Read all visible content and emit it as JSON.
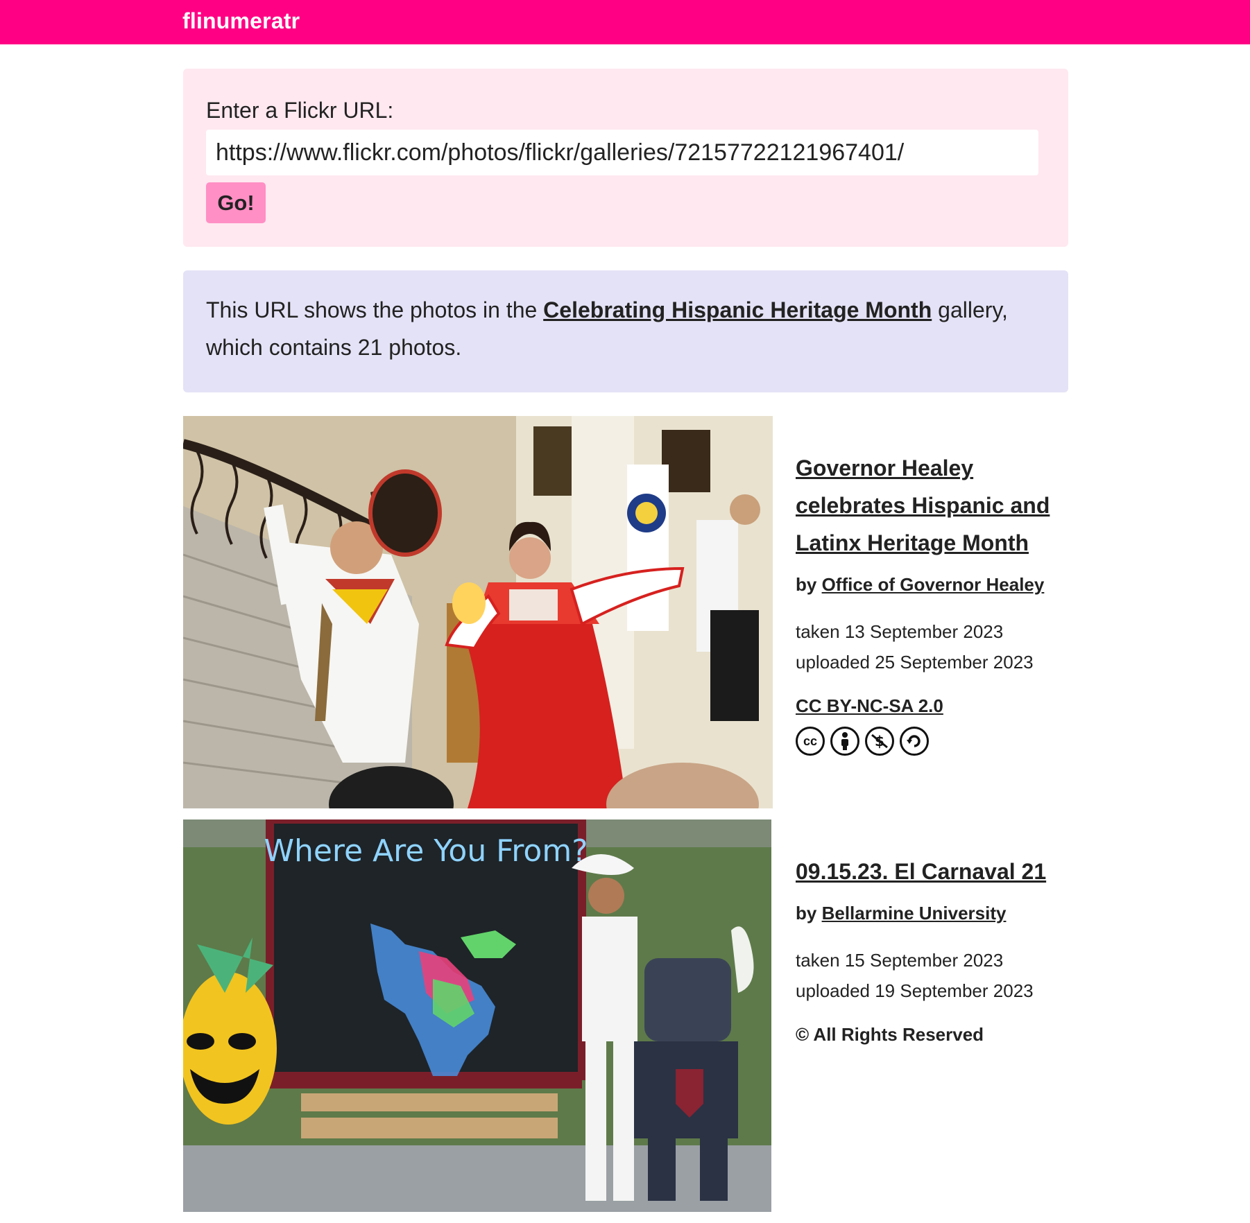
{
  "app": {
    "name": "flinumeratr"
  },
  "form": {
    "label": "Enter a Flickr URL:",
    "url_value": "https://www.flickr.com/photos/flickr/galleries/72157722121967401/",
    "go_label": "Go!"
  },
  "info": {
    "prefix": "This URL shows the photos in the",
    "gallery_title": "Celebrating Hispanic Heritage Month",
    "suffix": "gallery, which contains 21 photos."
  },
  "photos": [
    {
      "title": "Governor Healey celebrates Hispanic and Latinx Heritage Month",
      "by_prefix": "by",
      "owner": "Office of Governor Healey",
      "taken": "taken 13 September 2023",
      "uploaded": "uploaded 25 September 2023",
      "license": "CC BY-NC-SA 2.0",
      "license_icons": [
        "cc-icon",
        "attribution-icon",
        "non-commercial-icon",
        "share-alike-icon"
      ]
    },
    {
      "title": "09.15.23. El Carnaval 21",
      "by_prefix": "by",
      "owner": "Bellarmine University",
      "taken": "taken 15 September 2023",
      "uploaded": "uploaded 19 September 2023",
      "license": "© All Rights Reserved",
      "chalkboard_text": "Where Are You From?"
    }
  ],
  "colors": {
    "brand": "#ff0084",
    "form_bg": "#ffe8f0",
    "button": "#ff8fc4",
    "info_bg": "#e4e2f6"
  }
}
